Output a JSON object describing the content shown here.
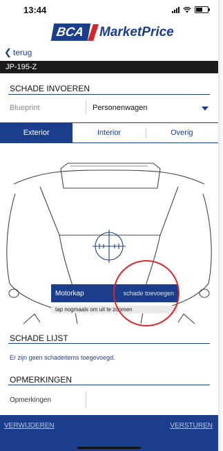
{
  "status_bar": {
    "time": "13:44"
  },
  "logo": {
    "brand": "BCA",
    "product": "MarketPrice"
  },
  "nav": {
    "back_label": "terug"
  },
  "vehicle": {
    "plate": "JP-195-Z"
  },
  "damage_entry": {
    "title": "SCHADE INVOEREN",
    "blueprint_label": "Blueprint",
    "blueprint_value": "Personenwagen",
    "tabs": [
      {
        "label": "Exterior",
        "active": true
      },
      {
        "label": "Interior",
        "active": false
      },
      {
        "label": "Overig",
        "active": false
      }
    ]
  },
  "popup": {
    "part": "Motorkap",
    "add_label": "schade toevoegen",
    "hint": "tap nogmaals om uit te zoomen"
  },
  "damage_list": {
    "title": "SCHADE LIJST",
    "empty_text": "Er zijn geen schadeitems toegevoegd."
  },
  "remarks": {
    "title": "OPMERKINGEN",
    "label": "Opmerkingen",
    "value": ""
  },
  "actions": {
    "delete_label": "VERWIJDEREN",
    "send_label": "VERSTUREN"
  },
  "colors": {
    "brand_blue": "#1a3e8c",
    "brand_red": "#d7232a",
    "highlight_red": "#e0252b"
  }
}
